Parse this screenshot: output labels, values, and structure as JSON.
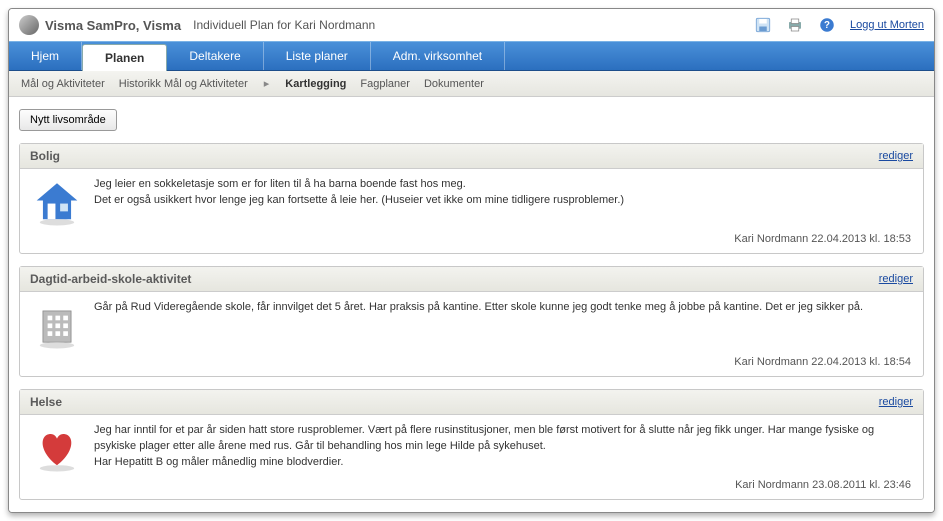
{
  "header": {
    "app_title": "Visma SamPro, Visma",
    "subtitle": "Individuell Plan for Kari Nordmann",
    "logout_label": "Logg ut Morten"
  },
  "tabs": {
    "hjem": "Hjem",
    "planen": "Planen",
    "deltakere": "Deltakere",
    "liste_planer": "Liste planer",
    "adm": "Adm. virksomhet"
  },
  "subnav": {
    "mal": "Mål og Aktiviteter",
    "historikk": "Historikk Mål og Aktiviteter",
    "kartlegging": "Kartlegging",
    "fagplaner": "Fagplaner",
    "dokumenter": "Dokumenter"
  },
  "buttons": {
    "new_area": "Nytt livsområde",
    "edit": "rediger"
  },
  "sections": {
    "bolig": {
      "title": "Bolig",
      "text": "Jeg leier en sokkeletasje som er for liten til å ha barna boende fast hos meg.\nDet er også usikkert hvor lenge jeg kan fortsette å leie her. (Huseier vet ikke om mine tidligere rusproblemer.)",
      "meta": "Kari Nordmann 22.04.2013 kl. 18:53"
    },
    "dagtid": {
      "title": "Dagtid-arbeid-skole-aktivitet",
      "text": "Går på Rud Videregående skole, får innvilget det 5 året. Har praksis på kantine. Etter skole kunne jeg godt tenke meg å jobbe på kantine. Det er jeg sikker på.",
      "meta": "Kari Nordmann 22.04.2013 kl. 18:54"
    },
    "helse": {
      "title": "Helse",
      "text": "Jeg har inntil for et par år siden hatt store rusproblemer. Vært på flere rusinstitusjoner, men ble først motivert for å slutte når jeg fikk unger.  Har mange fysiske og psykiske plager etter alle årene med rus. Går til behandling hos min lege Hilde på sykehuset.\nHar Hepatitt B og måler månedlig mine blodverdier.",
      "meta": "Kari Nordmann 23.08.2011 kl. 23:46"
    }
  }
}
